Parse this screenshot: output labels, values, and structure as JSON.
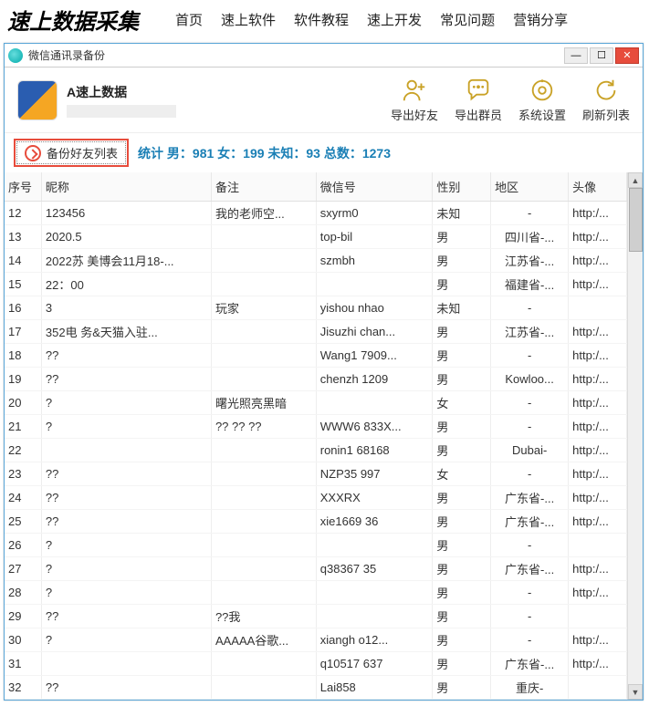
{
  "site": {
    "title": "速上数据采集",
    "nav": [
      "首页",
      "速上软件",
      "软件教程",
      "速上开发",
      "常见问题",
      "营销分享"
    ]
  },
  "window": {
    "title": "微信通讯录备份"
  },
  "toolbar": {
    "app_name": "A速上数据",
    "actions": {
      "export_friends": "导出好友",
      "export_group": "导出群员",
      "settings": "系统设置",
      "refresh": "刷新列表"
    }
  },
  "stats": {
    "backup_btn": "备份好友列表",
    "text": "统计 男：981 女：199 未知：93 总数：1273"
  },
  "columns": {
    "idx": "序号",
    "nick": "昵称",
    "remark": "备注",
    "wxid": "微信号",
    "gender": "性别",
    "region": "地区",
    "avatar": "头像"
  },
  "rows": [
    {
      "idx": "12",
      "nick": "123456",
      "remark": "我的老师空...",
      "wxid": "sxyrm0",
      "gender": "未知",
      "region": "-",
      "avatar": "http:/..."
    },
    {
      "idx": "13",
      "nick": "2020.5",
      "remark": "",
      "wxid": "top-bil",
      "gender": "男",
      "region": "四川省-...",
      "avatar": "http:/..."
    },
    {
      "idx": "14",
      "nick": "2022苏    美博会11月18-...",
      "remark": "",
      "wxid": "szmbh",
      "gender": "男",
      "region": "江苏省-...",
      "avatar": "http:/..."
    },
    {
      "idx": "15",
      "nick": "22：00",
      "remark": "",
      "wxid": "",
      "gender": "男",
      "region": "福建省-...",
      "avatar": "http:/..."
    },
    {
      "idx": "16",
      "nick": "3",
      "remark": "玩家",
      "wxid": "yishou      nhao",
      "gender": "未知",
      "region": "-",
      "avatar": ""
    },
    {
      "idx": "17",
      "nick": "352电    务&天猫入驻...",
      "remark": "",
      "wxid": "Jisuzhi    chan...",
      "gender": "男",
      "region": "江苏省-...",
      "avatar": "http:/..."
    },
    {
      "idx": "18",
      "nick": "??",
      "remark": "",
      "wxid": "Wang1    7909...",
      "gender": "男",
      "region": "-",
      "avatar": "http:/..."
    },
    {
      "idx": "19",
      "nick": "??",
      "remark": "",
      "wxid": "chenzh    1209",
      "gender": "男",
      "region": "Kowloo...",
      "avatar": "http:/..."
    },
    {
      "idx": "20",
      "nick": "?",
      "remark": "曙光照亮黑暗",
      "wxid": "",
      "gender": "女",
      "region": "-",
      "avatar": "http:/..."
    },
    {
      "idx": "21",
      "nick": "?",
      "remark": "?? ?? ??",
      "wxid": "WWW6    833X...",
      "gender": "男",
      "region": "-",
      "avatar": "http:/..."
    },
    {
      "idx": "22",
      "nick": "",
      "remark": "",
      "wxid": "ronin1     68168",
      "gender": "男",
      "region": "Dubai-",
      "avatar": "http:/..."
    },
    {
      "idx": "23",
      "nick": "??",
      "remark": "",
      "wxid": "NZP35    997",
      "gender": "女",
      "region": "-",
      "avatar": "http:/..."
    },
    {
      "idx": "24",
      "nick": "??",
      "remark": "",
      "wxid": "XXXRX",
      "gender": "男",
      "region": "广东省-...",
      "avatar": "http:/..."
    },
    {
      "idx": "25",
      "nick": "??",
      "remark": "",
      "wxid": "xie1669    36",
      "gender": "男",
      "region": "广东省-...",
      "avatar": "http:/..."
    },
    {
      "idx": "26",
      "nick": "?",
      "remark": "",
      "wxid": "",
      "gender": "男",
      "region": "-",
      "avatar": ""
    },
    {
      "idx": "27",
      "nick": "?",
      "remark": "",
      "wxid": "q38367    35",
      "gender": "男",
      "region": "广东省-...",
      "avatar": "http:/..."
    },
    {
      "idx": "28",
      "nick": "?",
      "remark": "",
      "wxid": "",
      "gender": "男",
      "region": "-",
      "avatar": "http:/..."
    },
    {
      "idx": "29",
      "nick": "??",
      "remark": "??我",
      "wxid": "",
      "gender": "男",
      "region": "-",
      "avatar": ""
    },
    {
      "idx": "30",
      "nick": "?",
      "remark": "AAAAA谷歌...",
      "wxid": "xiangh      o12...",
      "gender": "男",
      "region": "-",
      "avatar": "http:/..."
    },
    {
      "idx": "31",
      "nick": "",
      "remark": "",
      "wxid": "q10517    637",
      "gender": "男",
      "region": "广东省-...",
      "avatar": "http:/..."
    },
    {
      "idx": "32",
      "nick": "??",
      "remark": "",
      "wxid": "Lai858",
      "gender": "男",
      "region": "重庆-",
      "avatar": ""
    }
  ]
}
